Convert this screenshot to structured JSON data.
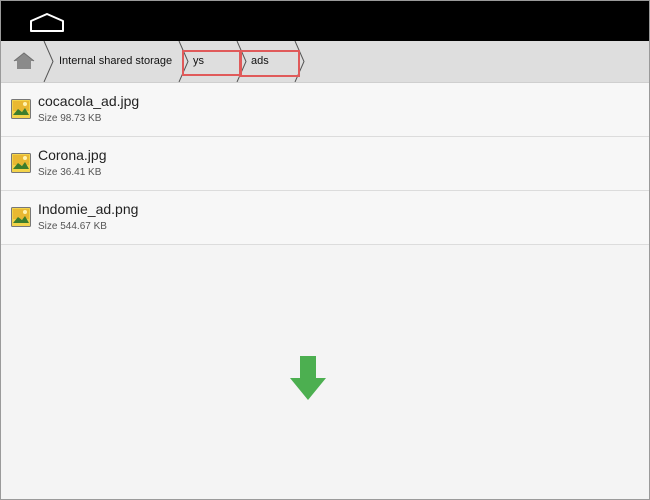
{
  "system_bar": {
    "home_icon": "home-outline-icon"
  },
  "breadcrumb": {
    "home_icon": "house-icon",
    "items": [
      {
        "label": "Internal shared storage"
      },
      {
        "label": "ys"
      },
      {
        "label": "ads"
      }
    ]
  },
  "files": [
    {
      "name": "cocacola_ad.jpg",
      "size": "Size 98.73 KB",
      "icon": "image-file-icon"
    },
    {
      "name": "Corona.jpg",
      "size": "Size 36.41 KB",
      "icon": "image-file-icon"
    },
    {
      "name": "Indomie_ad.png",
      "size": "Size 544.67 KB",
      "icon": "image-file-icon"
    }
  ],
  "overlay": {
    "download_icon": "download-arrow-icon",
    "download_color": "#4caf50",
    "highlight_color": "#e05a5a"
  }
}
